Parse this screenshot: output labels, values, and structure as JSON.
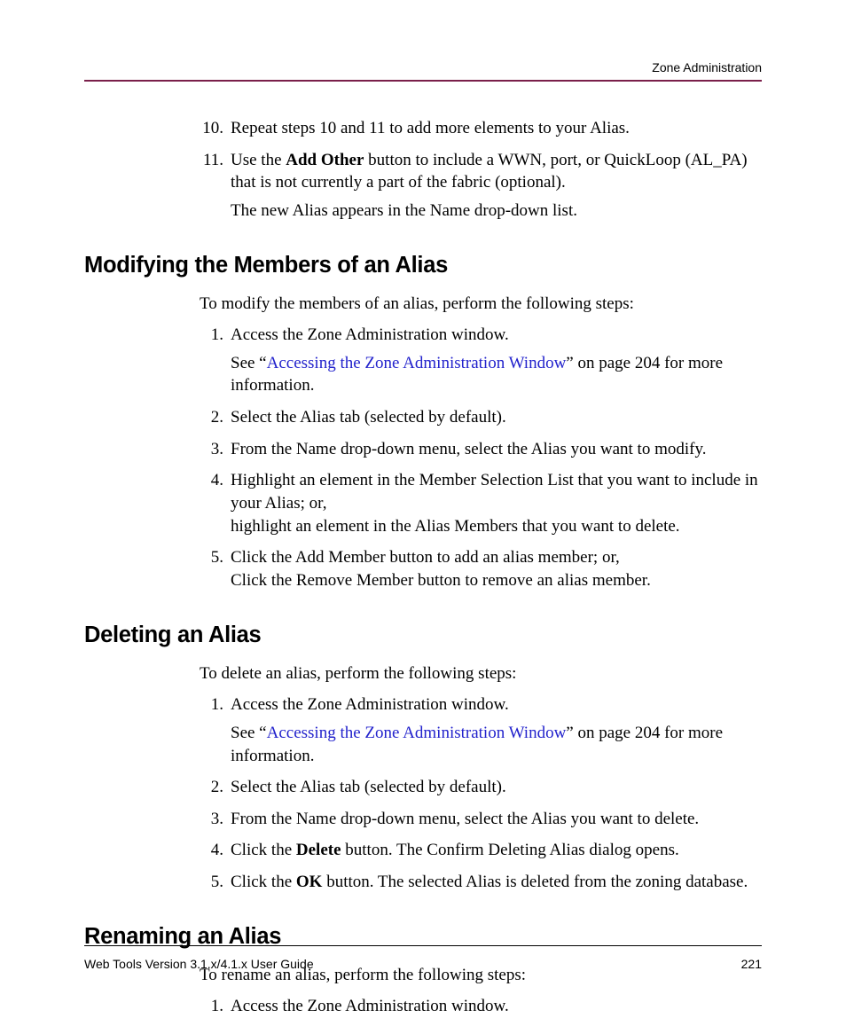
{
  "runningHead": "Zone Administration",
  "topList": {
    "item10": {
      "num": "10.",
      "text": "Repeat steps 10 and 11 to add more elements to your Alias."
    },
    "item11": {
      "num": "11.",
      "pre": "Use the ",
      "bold": "Add Other",
      "post": " button to include a WWN, port, or QuickLoop (AL_PA) that is not currently a part of the fabric (optional).",
      "follow": "The new Alias appears in the Name drop-down list."
    }
  },
  "section1": {
    "heading": "Modifying the Members of an Alias",
    "intro": "To modify the members of an alias, perform the following steps:",
    "items": {
      "i1": {
        "num": "1.",
        "text": "Access the Zone Administration window.",
        "seePre": "See “",
        "seeLink": "Accessing the Zone Administration Window",
        "seePost": "” on page 204 for more information."
      },
      "i2": {
        "num": "2.",
        "text": "Select the Alias tab (selected by default)."
      },
      "i3": {
        "num": "3.",
        "text": "From the Name drop-down menu, select the Alias you want to modify."
      },
      "i4": {
        "num": "4.",
        "line1": "Highlight an element in the Member Selection List that you want to include in your Alias; or,",
        "line2": "highlight an element in the Alias Members that you want to delete."
      },
      "i5": {
        "num": "5.",
        "line1": "Click the Add Member button to add an alias member; or,",
        "line2": "Click the Remove Member button to remove an alias member."
      }
    }
  },
  "section2": {
    "heading": "Deleting an Alias",
    "intro": "To delete an alias, perform the following steps:",
    "items": {
      "i1": {
        "num": "1.",
        "text": "Access the Zone Administration window.",
        "seePre": "See “",
        "seeLink": "Accessing the Zone Administration Window",
        "seePost": "” on page 204 for more information."
      },
      "i2": {
        "num": "2.",
        "text": "Select the Alias tab (selected by default)."
      },
      "i3": {
        "num": "3.",
        "text": "From the Name drop-down menu, select the Alias you want to delete."
      },
      "i4": {
        "num": "4.",
        "pre": "Click the ",
        "bold": "Delete",
        "post": " button. The Confirm Deleting Alias dialog opens."
      },
      "i5": {
        "num": "5.",
        "pre": "Click the ",
        "bold": "OK",
        "post": " button. The selected Alias is deleted from the zoning database."
      }
    }
  },
  "section3": {
    "heading": "Renaming an Alias",
    "intro": "To rename an alias, perform the following steps:",
    "items": {
      "i1": {
        "num": "1.",
        "text": "Access the Zone Administration window."
      }
    }
  },
  "footer": {
    "left": "Web Tools Version 3.1.x/4.1.x User Guide",
    "right": "221"
  }
}
